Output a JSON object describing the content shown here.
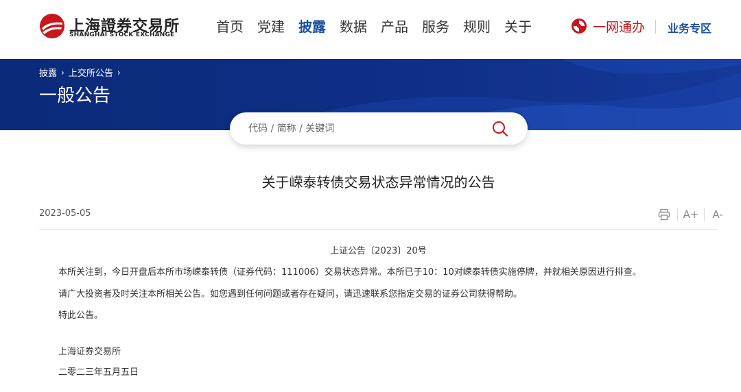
{
  "header": {
    "logo": {
      "name_cn": "上海證券交易所",
      "name_en": "SHANGHAI STOCK EXCHANGE",
      "brand_color": "#c8161d"
    },
    "nav": [
      {
        "label": "首页",
        "active": false
      },
      {
        "label": "党建",
        "active": false
      },
      {
        "label": "披露",
        "active": true
      },
      {
        "label": "数据",
        "active": false
      },
      {
        "label": "产品",
        "active": false
      },
      {
        "label": "服务",
        "active": false
      },
      {
        "label": "规则",
        "active": false
      },
      {
        "label": "关于",
        "active": false
      }
    ],
    "yiwang_label": "一网通办",
    "yewu_label": "业务专区",
    "accent_color": "#1a4fa3"
  },
  "banner": {
    "breadcrumb": [
      "披露",
      "上交所公告"
    ],
    "title": "一般公告"
  },
  "search": {
    "placeholder": "代码 / 简称 / 关键词",
    "icon": "search-icon"
  },
  "article": {
    "title": "关于嵘泰转债交易状态异常情况的公告",
    "date": "2023-05-05",
    "tools": {
      "print_icon": "print-icon",
      "font_increase_label": "A+",
      "font_decrease_label": "A-"
    },
    "doc_number": "上证公告〔2023〕20号",
    "paragraphs": [
      "本所关注到，今日开盘后本所市场嵘泰转债（证券代码：111006）交易状态异常。本所已于10：10对嵘泰转债实施停牌，并就相关原因进行排查。",
      "请广大投资者及时关注本所相关公告。如您遇到任何问题或者存在疑问，请迅速联系您指定交易的证券公司获得帮助。",
      "特此公告。"
    ],
    "signature": "上海证券交易所",
    "signature_date": "二零二三年五月五日"
  }
}
